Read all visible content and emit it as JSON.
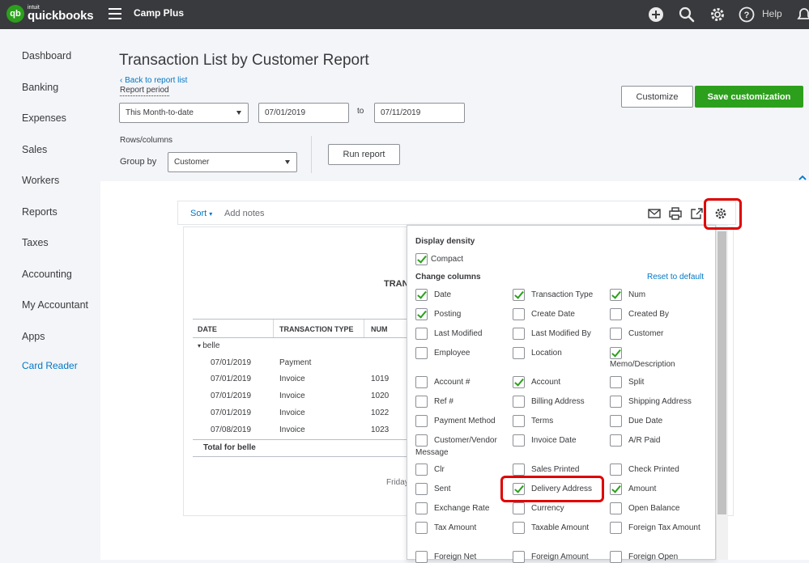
{
  "topbar": {
    "logo_brand": "intuit",
    "logo_product": "quickbooks",
    "logo_mark": "qb",
    "company": "Camp Plus",
    "help_label": "Help",
    "icons": [
      "plus-circle-icon",
      "search-icon",
      "gear-icon",
      "help-circle-icon",
      "bell-icon"
    ]
  },
  "sidebar": {
    "items": [
      {
        "label": "Dashboard"
      },
      {
        "label": "Banking"
      },
      {
        "label": "Expenses"
      },
      {
        "label": "Sales"
      },
      {
        "label": "Workers"
      },
      {
        "label": "Reports"
      },
      {
        "label": "Taxes"
      },
      {
        "label": "Accounting"
      },
      {
        "label": "My Accountant"
      },
      {
        "label": "Apps"
      },
      {
        "label": "Card Reader"
      }
    ],
    "active_color": "#0077c5"
  },
  "header": {
    "title": "Transaction List by Customer Report",
    "back_link": "Back to report list",
    "report_period_label": "Report period",
    "period_select": "This Month-to-date",
    "date_from": "07/01/2019",
    "to_label": "to",
    "date_to": "07/11/2019",
    "rows_columns_label": "Rows/columns",
    "group_by_label": "Group by",
    "group_by_value": "Customer",
    "run_report": "Run report",
    "customize": "Customize",
    "save_customization": "Save customization"
  },
  "toolbar": {
    "sort": "Sort",
    "add_notes": "Add notes",
    "icons": [
      "email-icon",
      "print-icon",
      "export-icon",
      "gear-icon"
    ]
  },
  "report": {
    "heading": "TRAN",
    "columns": [
      "DATE",
      "TRANSACTION TYPE",
      "NUM"
    ],
    "group_name": "belle",
    "rows": [
      {
        "date": "07/01/2019",
        "type": "Payment",
        "num": ""
      },
      {
        "date": "07/01/2019",
        "type": "Invoice",
        "num": "1019"
      },
      {
        "date": "07/01/2019",
        "type": "Invoice",
        "num": "1020"
      },
      {
        "date": "07/01/2019",
        "type": "Invoice",
        "num": "1022"
      },
      {
        "date": "07/08/2019",
        "type": "Invoice",
        "num": "1023"
      }
    ],
    "total_label": "Total for belle",
    "footer": "Friday"
  },
  "settings": {
    "display_density_title": "Display density",
    "compact": {
      "label": "Compact",
      "checked": true
    },
    "change_columns_title": "Change columns",
    "reset_default": "Reset to default",
    "columns": [
      {
        "label": "Date",
        "checked": true
      },
      {
        "label": "Transaction Type",
        "checked": true
      },
      {
        "label": "Num",
        "checked": true
      },
      {
        "label": "Posting",
        "checked": true
      },
      {
        "label": "Create Date",
        "checked": false
      },
      {
        "label": "Created By",
        "checked": false
      },
      {
        "label": "Last Modified",
        "checked": false
      },
      {
        "label": "Last Modified By",
        "checked": false
      },
      {
        "label": "Customer",
        "checked": false
      },
      {
        "label": "Employee",
        "checked": false
      },
      {
        "label": "Location",
        "checked": false
      },
      {
        "label": "Memo/Description",
        "checked": true
      },
      {
        "label": "Account #",
        "checked": false
      },
      {
        "label": "Account",
        "checked": true
      },
      {
        "label": "Split",
        "checked": false
      },
      {
        "label": "Ref #",
        "checked": false
      },
      {
        "label": "Billing Address",
        "checked": false
      },
      {
        "label": "Shipping Address",
        "checked": false
      },
      {
        "label": "Payment Method",
        "checked": false
      },
      {
        "label": "Terms",
        "checked": false
      },
      {
        "label": "Due Date",
        "checked": false
      },
      {
        "label": "Customer/Vendor Message",
        "checked": false
      },
      {
        "label": "Invoice Date",
        "checked": false
      },
      {
        "label": "A/R Paid",
        "checked": false
      },
      {
        "label": "Clr",
        "checked": false
      },
      {
        "label": "Sales Printed",
        "checked": false
      },
      {
        "label": "Check Printed",
        "checked": false
      },
      {
        "label": "Sent",
        "checked": false
      },
      {
        "label": "Delivery Address",
        "checked": true
      },
      {
        "label": "Amount",
        "checked": true
      },
      {
        "label": "Exchange Rate",
        "checked": false
      },
      {
        "label": "Currency",
        "checked": false
      },
      {
        "label": "Open Balance",
        "checked": false
      },
      {
        "label": "Tax Amount",
        "checked": false
      },
      {
        "label": "Taxable Amount",
        "checked": false
      },
      {
        "label": "Foreign Tax Amount",
        "checked": false
      },
      {
        "label": "Foreign Net",
        "checked": false
      },
      {
        "label": "Foreign Amount",
        "checked": false
      },
      {
        "label": "Foreign Open",
        "checked": false
      }
    ]
  },
  "colors": {
    "topbar": "#393a3d",
    "accent_green": "#2ca01c",
    "link_blue": "#0077c5",
    "highlight_red": "#e00000"
  }
}
